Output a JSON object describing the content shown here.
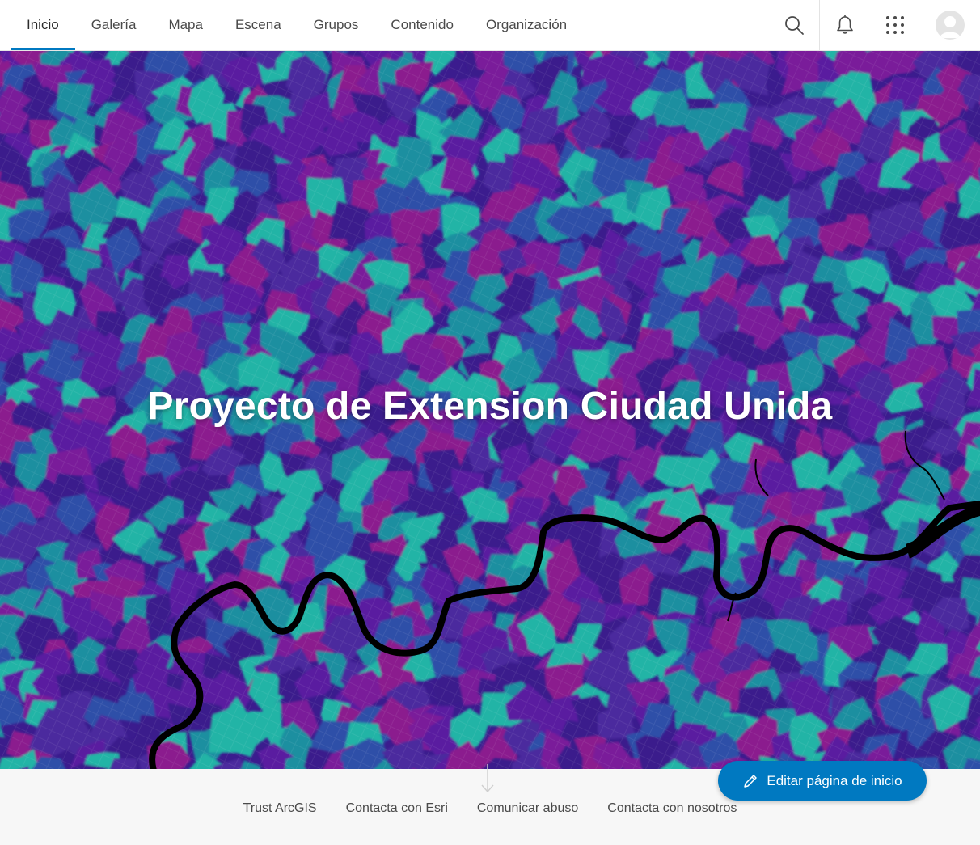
{
  "nav": {
    "tabs": [
      {
        "label": "Inicio",
        "active": true
      },
      {
        "label": "Galería"
      },
      {
        "label": "Mapa"
      },
      {
        "label": "Escena"
      },
      {
        "label": "Grupos"
      },
      {
        "label": "Contenido"
      },
      {
        "label": "Organización"
      }
    ],
    "tools": [
      "search-icon",
      "bell-icon",
      "app-launcher-icon",
      "avatar"
    ]
  },
  "hero": {
    "title": "Proyecto de Extension Ciudad Unida",
    "palette": [
      "#3a1a8c",
      "#5a1fa0",
      "#7a1f9a",
      "#8b1e8e",
      "#2d4fa8",
      "#1f8fa0",
      "#20b4a6",
      "#4b2a9e"
    ]
  },
  "edit_button": {
    "label": "Editar página de inicio",
    "icon": "pencil-icon"
  },
  "footer": {
    "links": [
      "Trust ArcGIS",
      "Contacta con Esri",
      "Comunicar abuso",
      "Contacta con nosotros"
    ]
  },
  "colors": {
    "accent": "#0079c1"
  }
}
